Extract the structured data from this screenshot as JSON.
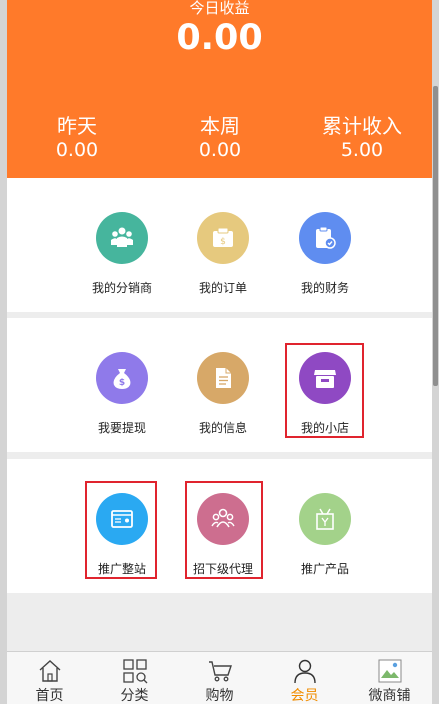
{
  "header": {
    "today_label": "今日收益",
    "today_value": "0.00",
    "stats": [
      {
        "label": "昨天",
        "value": "0.00"
      },
      {
        "label": "本周",
        "value": "0.00"
      },
      {
        "label": "累计收入",
        "value": "5.00"
      }
    ],
    "color": "#ff7a2a"
  },
  "menu": [
    {
      "label": "我的分销商",
      "icon": "people-icon",
      "color": "#46b59d"
    },
    {
      "label": "我的订单",
      "icon": "order-icon",
      "color": "#e6c97e"
    },
    {
      "label": "我的财务",
      "icon": "finance-icon",
      "color": "#5f8df0"
    },
    {
      "label": "我要提现",
      "icon": "money-bag-icon",
      "color": "#8f7aea"
    },
    {
      "label": "我的信息",
      "icon": "document-icon",
      "color": "#d7a868"
    },
    {
      "label": "我的小店",
      "icon": "shop-icon",
      "color": "#8f49c3"
    },
    {
      "label": "推广整站",
      "icon": "website-icon",
      "color": "#2aa9f2"
    },
    {
      "label": "招下级代理",
      "icon": "team-icon",
      "color": "#cd6e8f"
    },
    {
      "label": "推广产品",
      "icon": "gift-icon",
      "color": "#a3d28a"
    }
  ],
  "bottom_nav": [
    {
      "label": "首页",
      "icon": "home-icon"
    },
    {
      "label": "分类",
      "icon": "category-icon"
    },
    {
      "label": "购物",
      "icon": "cart-icon"
    },
    {
      "label": "会员",
      "icon": "user-icon",
      "active": true
    },
    {
      "label": "微商铺",
      "icon": "image-icon"
    }
  ],
  "colors": {
    "highlight": "#e0242e",
    "active_nav": "#f08c00"
  }
}
